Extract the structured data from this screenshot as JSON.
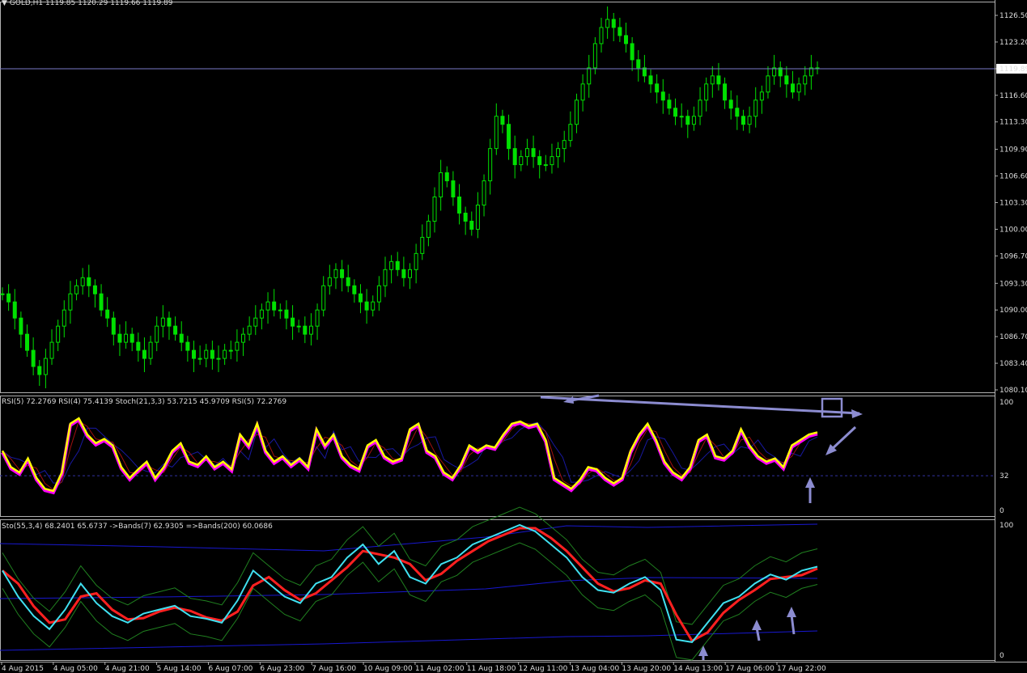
{
  "header": {
    "symbol": "GOLD,H1",
    "ohlc": "1119.85 1120.29 1119.66 1119.89"
  },
  "price_axis": {
    "ticks": [
      "1126.50",
      "1123.20",
      "1119.89",
      "1116.60",
      "1113.30",
      "1109.90",
      "1106.60",
      "1103.30",
      "1100.00",
      "1096.70",
      "1093.30",
      "1090.00",
      "1086.70",
      "1083.40",
      "1080.10"
    ],
    "current_price": "1119.89"
  },
  "osc1": {
    "header": "RSI(5) 72.2769  RSI(4) 75.4139  Stoch(21,3,3) 53.7215 45.9709  RSI(5) 72.2769",
    "ticks": [
      "100",
      "32",
      "0"
    ]
  },
  "osc2": {
    "header": "Sto(55,3,4) 68.2401 65.6737  ->Bands(7) 62.9305  =>Bands(200) 60.0686",
    "ticks": [
      "100",
      "0"
    ]
  },
  "time_axis": [
    "4 Aug 2015",
    "4 Aug 05:00",
    "4 Aug 21:00",
    "5 Aug 14:00",
    "6 Aug 07:00",
    "6 Aug 23:00",
    "7 Aug 16:00",
    "10 Aug 09:00",
    "11 Aug 02:00",
    "11 Aug 18:00",
    "12 Aug 11:00",
    "13 Aug 04:00",
    "13 Aug 20:00",
    "14 Aug 13:00",
    "17 Aug 06:00",
    "17 Aug 22:00"
  ],
  "colors": {
    "background": "#000000",
    "candle": "#00e000",
    "price_line": "#7a7ac8",
    "rsi_main": "#ffff00",
    "rsi_shadow": "#ff00ff",
    "stoch_signal": "#ff2020",
    "stoch_main": "#40e0f0",
    "bands200": "#1818d0",
    "bands7": "#208020",
    "annotation": "#8c8cd0"
  },
  "chart_data": {
    "type": "candlestick",
    "title": "GOLD,H1",
    "ylim": [
      1080.1,
      1126.5
    ],
    "series": [
      {
        "name": "close",
        "values": [
          1092,
          1091,
          1089,
          1087,
          1085,
          1083,
          1082,
          1084,
          1086,
          1088,
          1090,
          1092,
          1093,
          1094,
          1093,
          1092,
          1090,
          1089,
          1087,
          1086,
          1087,
          1086,
          1085,
          1084,
          1086,
          1088,
          1089,
          1088,
          1087,
          1086,
          1085,
          1084,
          1084,
          1085,
          1084,
          1084,
          1085,
          1085,
          1086,
          1087,
          1088,
          1089,
          1090,
          1091,
          1090,
          1090,
          1089,
          1088,
          1088,
          1087,
          1088,
          1090,
          1093,
          1094,
          1095,
          1094,
          1093,
          1092,
          1091,
          1090,
          1091,
          1093,
          1095,
          1096,
          1095,
          1094,
          1095,
          1097,
          1099,
          1101,
          1104,
          1107,
          1106,
          1104,
          1102,
          1101,
          1100,
          1103,
          1106,
          1110,
          1114,
          1113,
          1110,
          1108,
          1109,
          1110,
          1109,
          1108,
          1108,
          1109,
          1110,
          1111,
          1113,
          1116,
          1118,
          1120,
          1123,
          1125,
          1126,
          1125,
          1124,
          1123,
          1121,
          1120,
          1119,
          1118,
          1117,
          1116,
          1115,
          1114,
          1114,
          1113,
          1114,
          1116,
          1118,
          1119,
          1118,
          1116,
          1115,
          1114,
          1113,
          1114,
          1116,
          1117,
          1119,
          1120,
          1119,
          1118,
          1117,
          1118,
          1119,
          1120,
          1120
        ]
      }
    ],
    "x_labels": [
      "4 Aug 2015",
      "4 Aug 05:00",
      "4 Aug 21:00",
      "5 Aug 14:00",
      "6 Aug 07:00",
      "6 Aug 23:00",
      "7 Aug 16:00",
      "10 Aug 09:00",
      "11 Aug 02:00",
      "11 Aug 18:00",
      "12 Aug 11:00",
      "13 Aug 04:00",
      "13 Aug 20:00",
      "14 Aug 13:00",
      "17 Aug 06:00",
      "17 Aug 22:00"
    ],
    "y_ticks": [
      1126.5,
      1123.2,
      1119.89,
      1116.6,
      1113.3,
      1109.9,
      1106.6,
      1103.3,
      1100.0,
      1096.7,
      1093.3,
      1090.0,
      1086.7,
      1083.4,
      1080.1
    ],
    "rsi_values": [
      55,
      40,
      35,
      48,
      30,
      20,
      18,
      35,
      80,
      85,
      70,
      62,
      66,
      60,
      40,
      30,
      38,
      45,
      30,
      40,
      55,
      62,
      45,
      42,
      50,
      40,
      45,
      38,
      70,
      60,
      80,
      55,
      45,
      50,
      42,
      48,
      40,
      75,
      60,
      70,
      50,
      42,
      38,
      60,
      65,
      50,
      45,
      48,
      75,
      80,
      55,
      50,
      35,
      30,
      42,
      60,
      55,
      60,
      58,
      70,
      80,
      82,
      78,
      80,
      65,
      30,
      25,
      20,
      28,
      40,
      38,
      30,
      25,
      30,
      55,
      70,
      80,
      65,
      45,
      35,
      30,
      40,
      65,
      70,
      50,
      48,
      55,
      75,
      60,
      50,
      45,
      48,
      40,
      60,
      65,
      70,
      72
    ],
    "stoch_values": [
      65,
      45,
      30,
      20,
      35,
      55,
      40,
      30,
      25,
      32,
      35,
      38,
      30,
      28,
      25,
      42,
      65,
      55,
      45,
      40,
      55,
      60,
      75,
      85,
      70,
      80,
      60,
      55,
      70,
      75,
      85,
      90,
      95,
      100,
      95,
      85,
      75,
      60,
      50,
      48,
      55,
      60,
      50,
      12,
      10,
      25,
      40,
      45,
      55,
      62,
      58,
      65,
      68
    ]
  }
}
